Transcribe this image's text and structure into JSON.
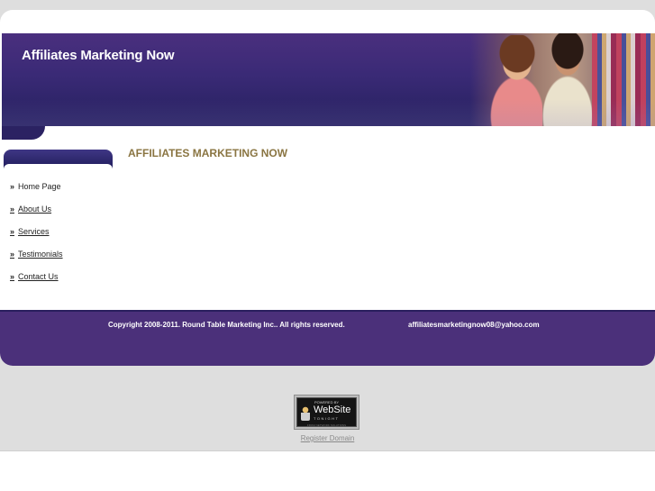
{
  "site": {
    "title": "Affiliates Marketing Now"
  },
  "nav": {
    "items": [
      {
        "label": "Home Page"
      },
      {
        "label": "About Us"
      },
      {
        "label": "Services"
      },
      {
        "label": "Testimonials"
      },
      {
        "label": "Contact Us"
      }
    ]
  },
  "main": {
    "heading": "AFFILIATES MARKETING NOW"
  },
  "footer": {
    "copyright": "Copyright 2008-2011. Round Table Marketing Inc.. All rights reserved.",
    "email": "affiliatesmarketingnow08@yahoo.com"
  },
  "badge": {
    "powered_by": "POWERED BY",
    "main": "WebSite",
    "sub": "TONIGHT",
    "foot": "FROM NETWORK SOLUTIONS",
    "icon": "website-tonight-logo-icon"
  },
  "register": {
    "label": "Register Domain"
  },
  "colors": {
    "header": "#3a2a76",
    "footer": "#4b307a",
    "heading": "#8a7542",
    "background": "#dedede"
  }
}
